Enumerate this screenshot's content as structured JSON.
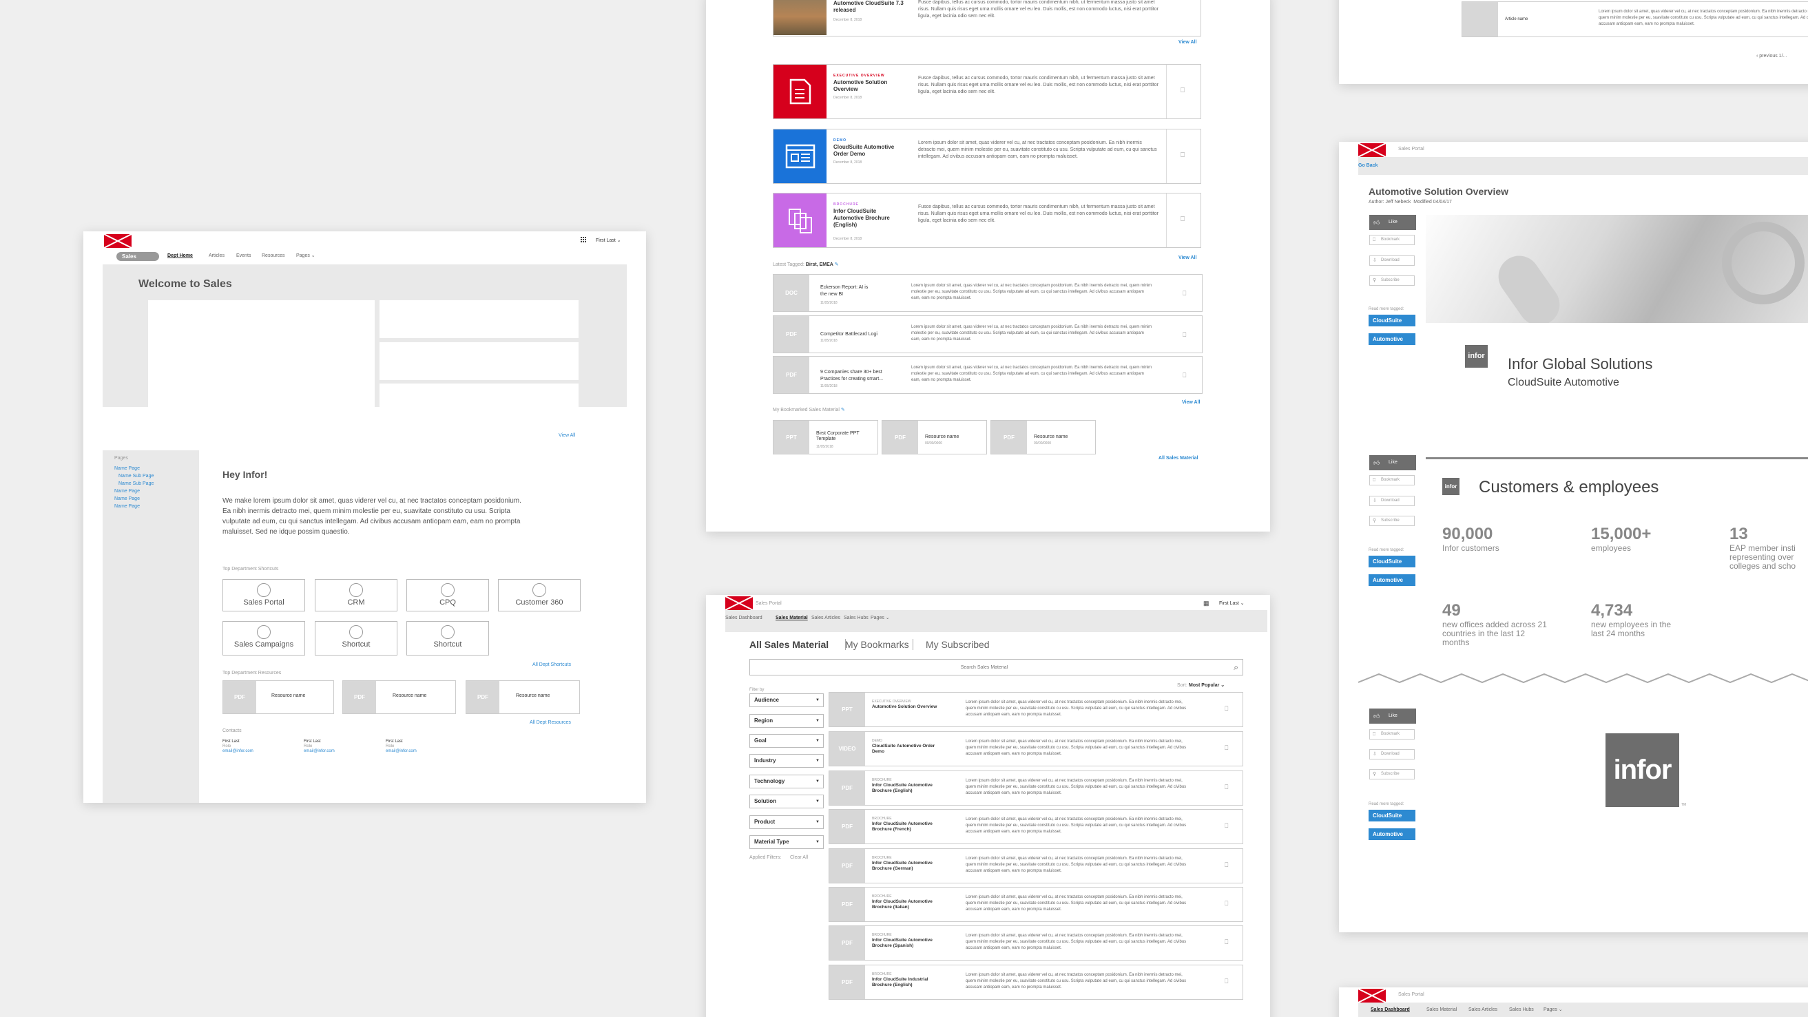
{
  "common": {
    "logo_icon": "infor-logo-icon",
    "sales_portal": "Sales Portal",
    "first_last": "First Last ⌄",
    "view_all": "View All",
    "pdf": "PDF",
    "doc": "DOC",
    "ppt": "PPT",
    "video": "VIDEO",
    "lorem_long": "Lorem ipsum dolor sit amet, quas viderer vel cu, at nec tractatos conceptam posidonium. Ea nibh inermis detracto mei, quem minim molestie per eu, suavitate constituto cu usu. Scripta vulputate ad eum, cu qui sanctus intellegam. Ad civibus accusam antiopam eam, eam no prompta maluisset.",
    "lorem_short": "Fusce dapibus, tellus ac cursus commodo, tortor mauris condimentum nibh, ut fermentum massa justo sit amet risus. Nullam quis risus eget urna mollis ornare vel eu leo. Duis mollis, est non commodo luctus, nisi erat porttitor ligula, eget lacinia odio sem nec elit."
  },
  "home": {
    "nav_pill": "Sales",
    "nav": [
      "Dept Home",
      "Articles",
      "Events",
      "Resources",
      "Pages ⌄"
    ],
    "user": "First Last ⌄",
    "title": "Welcome to Sales",
    "view_all": "View All",
    "pages_heading": "Pages",
    "pages": [
      "Name Page",
      "Name Sub Page",
      "Name Sub Page",
      "Name Page",
      "Name Page",
      "Name Page"
    ],
    "greeting": "Hey Infor!",
    "intro": "We make lorem ipsum dolor sit amet, quas viderer vel cu, at nec tractatos conceptam posidonium. Ea nibh inermis detracto mei, quem minim molestie per eu, suavitate constituto cu usu. Scripta vulputate ad eum, cu qui sanctus intellegam. Ad civibus accusam antiopam eam, eam no prompta maluisset. Sed ne idque possim quaestio.",
    "shortcuts_heading": "Top Department Shortcuts",
    "shortcuts": [
      "Sales Portal",
      "CRM",
      "CPQ",
      "Customer 360",
      "Sales Campaigns",
      "Shortcut",
      "Shortcut"
    ],
    "all_shortcuts": "All Dept Shortcuts",
    "resources_heading": "Top Department Resources",
    "resource_name": "Resource name",
    "all_resources": "All Dept Resources",
    "contacts_heading": "Contacts",
    "contacts": [
      {
        "name": "First Last",
        "role": "Role",
        "email": "email@infor.com"
      },
      {
        "name": "First Last",
        "role": "Role",
        "email": "email@infor.com"
      },
      {
        "name": "First Last",
        "role": "Role",
        "email": "email@infor.com"
      }
    ]
  },
  "feed": {
    "top_title": "Automotive CloudSuite 7.3 released",
    "top_date": "December 8, 2018",
    "view_all": "View All",
    "items": [
      {
        "tag": "EXECUTIVE OVERVIEW",
        "title": "Automotive Solution Overview",
        "date": "December 8, 2018",
        "color": "#d6001c",
        "icon": "document-icon"
      },
      {
        "tag": "DEMO",
        "title": "CloudSuite Automotive Order Demo",
        "date": "December 8, 2018",
        "color": "#1a73d9",
        "icon": "browser-window-icon"
      },
      {
        "tag": "BROCHURE",
        "title": "Infor CloudSuite Automotive Brochure (English)",
        "date": "December 8, 2018",
        "color": "#c86ae6",
        "icon": "copy-pages-icon"
      }
    ],
    "latest_label": "Latest Tagged:",
    "latest_tags": "Birst, EMEA",
    "latest": [
      {
        "thumb": "DOC",
        "title": "Eckerson Report: AI is the new BI",
        "date": "11/05/2018"
      },
      {
        "thumb": "PDF",
        "title": "Competitor Battlecard Logi",
        "date": "11/05/2018"
      },
      {
        "thumb": "PDF",
        "title": "9 Companies share 30+ best Practices for creating smart...",
        "date": "11/05/2018"
      }
    ],
    "bookmarked_heading": "My Bookmarked Sales Material",
    "bookmarks": [
      {
        "thumb": "PPT",
        "title": "Birst Corporate PPT Template",
        "date": "11/05/2018"
      },
      {
        "thumb": "PDF",
        "title": "Resource name",
        "date": "00/00/0000"
      },
      {
        "thumb": "PDF",
        "title": "Resource name",
        "date": "00/00/0000"
      }
    ],
    "all_sales_material": "All Sales Material"
  },
  "material": {
    "nav": [
      "Sales Dashboard",
      "Sales Material",
      "Sales Articles",
      "Sales Hubs",
      "Pages ⌄"
    ],
    "tabs": [
      "All Sales Material",
      "My Bookmarks",
      "My Subscribed"
    ],
    "search_placeholder": "Search Sales Material",
    "sort_label": "Sort:",
    "sort_value": "Most Popular ⌄",
    "filter_by": "Filter by",
    "filters": [
      "Audience",
      "Region",
      "Goal",
      "Industry",
      "Technology",
      "Solution",
      "Product",
      "Material Type"
    ],
    "applied": "Applied Filters:",
    "clear_all": "Clear All",
    "rows": [
      {
        "thumb": "PPT",
        "type": "EXECUTIVE OVERVIEW",
        "title": "Automotive Solution Overview"
      },
      {
        "thumb": "VIDEO",
        "type": "DEMO",
        "title": "CloudSuite Automotive Order Demo"
      },
      {
        "thumb": "PDF",
        "type": "BROCHURE",
        "title": "Infor CloudSuite Automotive Brochure (English)"
      },
      {
        "thumb": "PDF",
        "type": "BROCHURE",
        "title": "Infor CloudSuite Automotive Brochure (French)"
      },
      {
        "thumb": "PDF",
        "type": "BROCHURE",
        "title": "Infor CloudSuite Automotive Brochure (German)"
      },
      {
        "thumb": "PDF",
        "type": "BROCHURE",
        "title": "Infor CloudSuite Automotive Brochure (Italian)"
      },
      {
        "thumb": "PDF",
        "type": "BROCHURE",
        "title": "Infor CloudSuite Automotive Brochure (Spanish)"
      },
      {
        "thumb": "PDF",
        "type": "BROCHURE",
        "title": "Infor CloudSuite Industrial Brochure (English)"
      }
    ]
  },
  "article_list": {
    "article_name": "Article name",
    "pager": "‹ previous   1/..."
  },
  "detail": {
    "go_back": "Go Back",
    "title": "Automotive Solution Overview",
    "author": "Author: Jeff Nebeck",
    "modified": "Modified 04/04/17",
    "like": "Like",
    "actions": [
      "Bookmark",
      "Download",
      "Subscribe"
    ],
    "read_more": "Read more tagged:",
    "tags": [
      "CloudSuite",
      "Automotive"
    ],
    "slide1_logo": "infor",
    "slide1_title": "Infor Global Solutions",
    "slide1_sub": "CloudSuite Automotive",
    "slide2_title": "Customers & employees",
    "stats": [
      {
        "num": "90,000",
        "label": "Infor customers"
      },
      {
        "num": "15,000+",
        "label": "employees"
      },
      {
        "num": "13",
        "label": "EAP member insti representing over colleges and scho"
      },
      {
        "num": "49",
        "label": "new offices added across 21 countries in the last 12 months"
      },
      {
        "num": "4,734",
        "label": "new employees in the last 24 months"
      }
    ],
    "slide3_logo": "infor",
    "tm": "TM"
  },
  "dash_nav": [
    "Sales Dashboard",
    "Sales Material",
    "Sales Articles",
    "Sales Hubs",
    "Pages ⌄"
  ]
}
